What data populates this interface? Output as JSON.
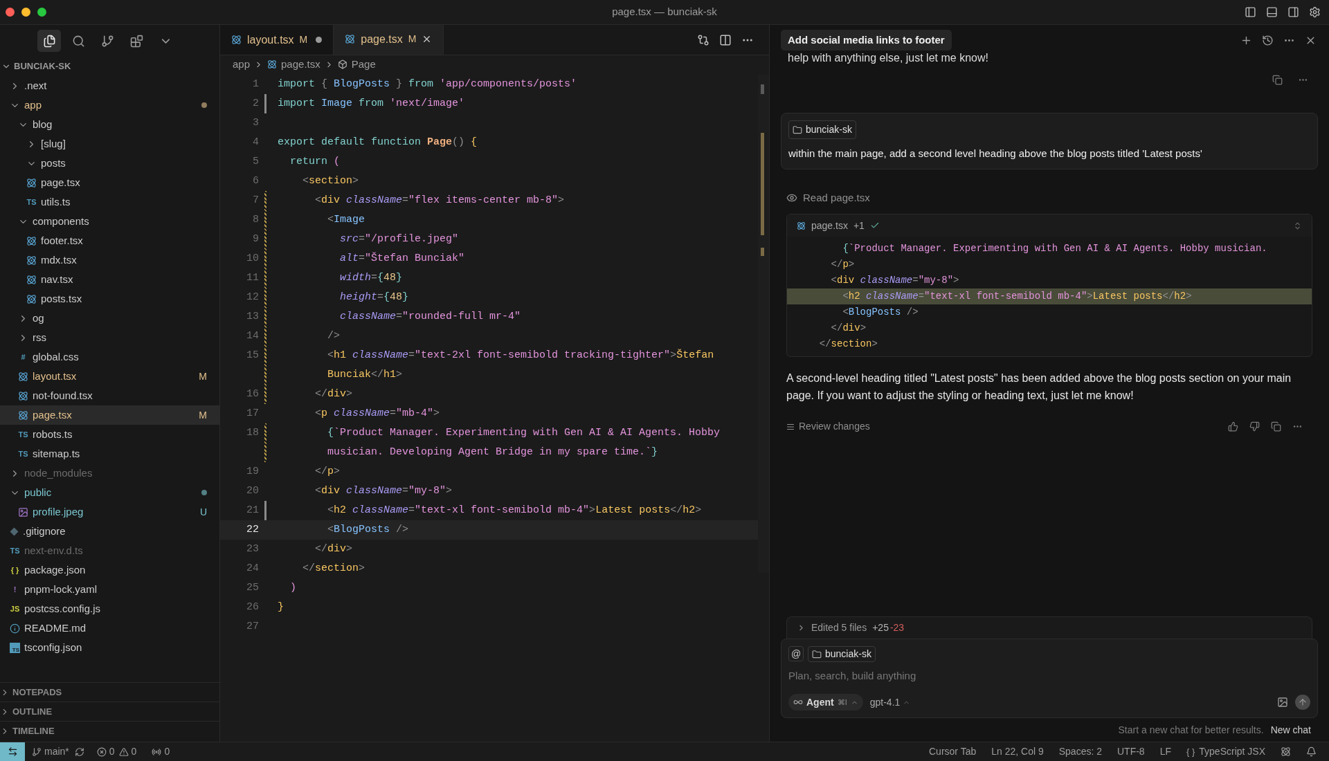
{
  "window": {
    "title": "page.tsx — bunciak-sk"
  },
  "activity": [
    {
      "kind": "explorer",
      "selected": true
    },
    {
      "kind": "search",
      "selected": false
    },
    {
      "kind": "source-control",
      "selected": false
    },
    {
      "kind": "extensions",
      "selected": false
    },
    {
      "kind": "more",
      "selected": false
    }
  ],
  "explorer": {
    "root": "BUNCIAK-SK",
    "items": [
      {
        "name": ".next",
        "kind": "folder",
        "expanded": false,
        "color": "#cccccc"
      },
      {
        "name": "app",
        "kind": "folder",
        "expanded": true,
        "color": "#e2c08d",
        "dot": true,
        "children": [
          {
            "name": "blog",
            "kind": "folder",
            "expanded": true,
            "color": "#cccccc",
            "children": [
              {
                "name": "[slug]",
                "kind": "folder",
                "expanded": false,
                "color": "#cccccc"
              },
              {
                "name": "posts",
                "kind": "folder",
                "expanded": true,
                "color": "#cccccc"
              },
              {
                "name": "page.tsx",
                "kind": "react",
                "color": "#cccccc",
                "selected": false
              },
              {
                "name": "utils.ts",
                "kind": "ts",
                "icon_text": "TS",
                "color": "#cccccc",
                "selected": false
              }
            ]
          },
          {
            "name": "components",
            "kind": "folder",
            "expanded": true,
            "color": "#cccccc",
            "children": [
              {
                "name": "footer.tsx",
                "kind": "react",
                "color": "#cccccc",
                "selected": false
              },
              {
                "name": "mdx.tsx",
                "kind": "react",
                "color": "#cccccc",
                "selected": false
              },
              {
                "name": "nav.tsx",
                "kind": "react",
                "color": "#cccccc",
                "selected": false
              },
              {
                "name": "posts.tsx",
                "kind": "react",
                "color": "#cccccc",
                "selected": false
              }
            ]
          },
          {
            "name": "og",
            "kind": "folder",
            "expanded": false,
            "color": "#cccccc"
          },
          {
            "name": "rss",
            "kind": "folder",
            "expanded": false,
            "color": "#cccccc"
          },
          {
            "name": "global.css",
            "kind": "css",
            "icon_text": "#",
            "color": "#cccccc",
            "selected": false
          },
          {
            "name": "layout.tsx",
            "kind": "react",
            "color": "#e2c08d",
            "badge": "M",
            "selected": false
          },
          {
            "name": "not-found.tsx",
            "kind": "react",
            "color": "#cccccc",
            "selected": false
          },
          {
            "name": "page.tsx",
            "kind": "react",
            "color": "#e2c08d",
            "badge": "M",
            "selected": true
          },
          {
            "name": "robots.ts",
            "kind": "ts",
            "icon_text": "TS",
            "color": "#cccccc",
            "selected": false
          },
          {
            "name": "sitemap.ts",
            "kind": "ts",
            "icon_text": "TS",
            "color": "#cccccc",
            "selected": false
          }
        ]
      },
      {
        "name": "node_modules",
        "kind": "folder",
        "expanded": false,
        "color": "#6b6b6b"
      },
      {
        "name": "public",
        "kind": "folder",
        "expanded": true,
        "color": "#7ac6cf",
        "dot": true,
        "children": [
          {
            "name": "profile.jpeg",
            "kind": "image",
            "color": "#7ac6cf",
            "badge": "U",
            "selected": false
          }
        ]
      },
      {
        "name": ".gitignore",
        "kind": "git",
        "color": "#cccccc",
        "selected": false
      },
      {
        "name": "next-env.d.ts",
        "kind": "ts",
        "icon_text": "TS",
        "color": "#6b6b6b",
        "selected": false
      },
      {
        "name": "package.json",
        "kind": "json",
        "icon_text": "{ }",
        "color": "#cccccc",
        "selected": false
      },
      {
        "name": "pnpm-lock.yaml",
        "kind": "yaml",
        "icon_text": "!",
        "color": "#cccccc",
        "selected": false
      },
      {
        "name": "postcss.config.js",
        "kind": "js",
        "icon_text": "JS",
        "color": "#cccccc",
        "selected": false
      },
      {
        "name": "README.md",
        "kind": "info",
        "color": "#cccccc",
        "selected": false
      },
      {
        "name": "tsconfig.json",
        "kind": "tsconfig",
        "icon_text": "TS",
        "color": "#cccccc",
        "selected": false
      }
    ]
  },
  "sections": [
    {
      "label": "NOTEPADS",
      "expanded": false
    },
    {
      "label": "OUTLINE",
      "expanded": false
    },
    {
      "label": "TIMELINE",
      "expanded": false
    }
  ],
  "tabs": [
    {
      "label": "layout.tsx",
      "status": "M",
      "dirty": true,
      "selected": false
    },
    {
      "label": "page.tsx",
      "status": "M",
      "dirty": false,
      "selected": true
    }
  ],
  "breadcrumb": [
    {
      "label": "app",
      "kind": "folder"
    },
    {
      "label": "page.tsx",
      "kind": "react"
    },
    {
      "label": "Page",
      "kind": "symbol"
    }
  ],
  "code": [
    {
      "number": "1",
      "current": false,
      "modified": false,
      "pending": false,
      "tokens": [
        {
          "kind": "kw",
          "text": "import"
        },
        {
          "kind": "p",
          "text": " { "
        },
        {
          "kind": "comp",
          "text": "BlogPosts"
        },
        {
          "kind": "p",
          "text": " } "
        },
        {
          "kind": "kw",
          "text": "from"
        },
        {
          "kind": "str",
          "text": " 'app/components/posts'"
        }
      ]
    },
    {
      "number": "2",
      "current": false,
      "modified": true,
      "pending": false,
      "tokens": [
        {
          "kind": "kw",
          "text": "import"
        },
        {
          "kind": "comp",
          "text": " Image"
        },
        {
          "kind": "kw",
          "text": " from"
        },
        {
          "kind": "str",
          "text": " 'next/image'"
        }
      ]
    },
    {
      "number": "3",
      "current": false,
      "modified": false,
      "pending": false
    },
    {
      "number": "4",
      "current": false,
      "modified": false,
      "pending": false,
      "tokens": [
        {
          "kind": "kw",
          "text": "export default function"
        },
        {
          "kind": "fn",
          "text": " Page"
        },
        {
          "kind": "p",
          "text": "() "
        },
        {
          "kind": "txt",
          "text": "{"
        }
      ]
    },
    {
      "number": "5",
      "current": false,
      "modified": false,
      "pending": false,
      "tokens": [
        {
          "kind": "kw",
          "text": "  return"
        },
        {
          "kind": "br",
          "text": " ("
        }
      ]
    },
    {
      "number": "6",
      "current": false,
      "modified": false,
      "pending": false,
      "tokens": [
        {
          "kind": "p",
          "text": "    <"
        },
        {
          "kind": "tag",
          "text": "section"
        },
        {
          "kind": "p",
          "text": ">"
        }
      ]
    },
    {
      "number": "7",
      "current": false,
      "modified": false,
      "pending": true,
      "tokens": [
        {
          "kind": "p",
          "text": "      <"
        },
        {
          "kind": "tag",
          "text": "div"
        },
        {
          "kind": "attr",
          "text": " className"
        },
        {
          "kind": "p",
          "text": "="
        },
        {
          "kind": "str",
          "text": "\"flex items-center mb-8\""
        },
        {
          "kind": "p",
          "text": ">"
        }
      ]
    },
    {
      "number": "8",
      "current": false,
      "modified": false,
      "pending": true,
      "tokens": [
        {
          "kind": "p",
          "text": "        <"
        },
        {
          "kind": "comp",
          "text": "Image"
        }
      ]
    },
    {
      "number": "9",
      "current": false,
      "modified": false,
      "pending": true,
      "tokens": [
        {
          "kind": "attr",
          "text": "          src"
        },
        {
          "kind": "p",
          "text": "="
        },
        {
          "kind": "str",
          "text": "\"/profile.jpeg\""
        }
      ]
    },
    {
      "number": "10",
      "current": false,
      "modified": false,
      "pending": true,
      "tokens": [
        {
          "kind": "attr",
          "text": "          alt"
        },
        {
          "kind": "p",
          "text": "="
        },
        {
          "kind": "str",
          "text": "\"Štefan Bunciak\""
        }
      ]
    },
    {
      "number": "11",
      "current": false,
      "modified": false,
      "pending": true,
      "tokens": [
        {
          "kind": "attr",
          "text": "          width"
        },
        {
          "kind": "p",
          "text": "="
        },
        {
          "kind": "brace",
          "text": "{"
        },
        {
          "kind": "num",
          "text": "48"
        },
        {
          "kind": "brace",
          "text": "}"
        }
      ]
    },
    {
      "number": "12",
      "current": false,
      "modified": false,
      "pending": true,
      "tokens": [
        {
          "kind": "attr",
          "text": "          height"
        },
        {
          "kind": "p",
          "text": "="
        },
        {
          "kind": "brace",
          "text": "{"
        },
        {
          "kind": "num",
          "text": "48"
        },
        {
          "kind": "brace",
          "text": "}"
        }
      ]
    },
    {
      "number": "13",
      "current": false,
      "modified": false,
      "pending": true,
      "tokens": [
        {
          "kind": "attr",
          "text": "          className"
        },
        {
          "kind": "p",
          "text": "="
        },
        {
          "kind": "str",
          "text": "\"rounded-full mr-4\""
        }
      ]
    },
    {
      "number": "14",
      "current": false,
      "modified": false,
      "pending": true,
      "tokens": [
        {
          "kind": "p",
          "text": "        />"
        }
      ]
    },
    {
      "number": "15",
      "current": false,
      "modified": false,
      "pending": true,
      "tokens": [
        {
          "kind": "p",
          "text": "        <"
        },
        {
          "kind": "tag",
          "text": "h1"
        },
        {
          "kind": "attr",
          "text": " className"
        },
        {
          "kind": "p",
          "text": "="
        },
        {
          "kind": "str",
          "text": "\"text-2xl font-semibold tracking-tighter\""
        },
        {
          "kind": "p",
          "text": ">"
        },
        {
          "kind": "txt",
          "text": "Štefan"
        }
      ],
      "continuation": [
        {
          "kind": "txt",
          "text": "        Bunciak"
        },
        {
          "kind": "p",
          "text": "</"
        },
        {
          "kind": "tag",
          "text": "h1"
        },
        {
          "kind": "p",
          "text": ">"
        }
      ]
    },
    {
      "number": "16",
      "current": false,
      "modified": false,
      "pending": true,
      "tokens": [
        {
          "kind": "p",
          "text": "      </"
        },
        {
          "kind": "tag",
          "text": "div"
        },
        {
          "kind": "p",
          "text": ">"
        }
      ]
    },
    {
      "number": "17",
      "current": false,
      "modified": false,
      "pending": false,
      "tokens": [
        {
          "kind": "p",
          "text": "      <"
        },
        {
          "kind": "tag",
          "text": "p"
        },
        {
          "kind": "attr",
          "text": " className"
        },
        {
          "kind": "p",
          "text": "="
        },
        {
          "kind": "str",
          "text": "\"mb-4\""
        },
        {
          "kind": "p",
          "text": ">"
        }
      ]
    },
    {
      "number": "18",
      "current": false,
      "modified": false,
      "pending": true,
      "tokens": [
        {
          "kind": "brace",
          "text": "        {"
        },
        {
          "kind": "str",
          "text": "`Product Manager. Experimenting with Gen AI & AI Agents. Hobby"
        }
      ],
      "continuation": [
        {
          "kind": "str",
          "text": "        musician. Developing Agent Bridge in my spare time.`"
        },
        {
          "kind": "brace",
          "text": "}"
        }
      ]
    },
    {
      "number": "19",
      "current": false,
      "modified": false,
      "pending": false,
      "tokens": [
        {
          "kind": "p",
          "text": "      </"
        },
        {
          "kind": "tag",
          "text": "p"
        },
        {
          "kind": "p",
          "text": ">"
        }
      ]
    },
    {
      "number": "20",
      "current": false,
      "modified": false,
      "pending": false,
      "tokens": [
        {
          "kind": "p",
          "text": "      <"
        },
        {
          "kind": "tag",
          "text": "div"
        },
        {
          "kind": "attr",
          "text": " className"
        },
        {
          "kind": "p",
          "text": "="
        },
        {
          "kind": "str",
          "text": "\"my-8\""
        },
        {
          "kind": "p",
          "text": ">"
        }
      ]
    },
    {
      "number": "21",
      "current": false,
      "modified": true,
      "pending": false,
      "tokens": [
        {
          "kind": "p",
          "text": "        <"
        },
        {
          "kind": "tag",
          "text": "h2"
        },
        {
          "kind": "attr",
          "text": " className"
        },
        {
          "kind": "p",
          "text": "="
        },
        {
          "kind": "str",
          "text": "\"text-xl font-semibold mb-4\""
        },
        {
          "kind": "p",
          "text": ">"
        },
        {
          "kind": "txt",
          "text": "Latest posts"
        },
        {
          "kind": "p",
          "text": "</"
        },
        {
          "kind": "tag",
          "text": "h2"
        },
        {
          "kind": "p",
          "text": ">"
        }
      ]
    },
    {
      "number": "22",
      "current": true,
      "modified": false,
      "pending": false,
      "tokens": [
        {
          "kind": "p",
          "text": "        <"
        },
        {
          "kind": "comp",
          "text": "BlogPosts"
        },
        {
          "kind": "p",
          "text": " />"
        }
      ]
    },
    {
      "number": "23",
      "current": false,
      "modified": false,
      "pending": false,
      "tokens": [
        {
          "kind": "p",
          "text": "      </"
        },
        {
          "kind": "tag",
          "text": "div"
        },
        {
          "kind": "p",
          "text": ">"
        }
      ]
    },
    {
      "number": "24",
      "current": false,
      "modified": false,
      "pending": false,
      "tokens": [
        {
          "kind": "p",
          "text": "    </"
        },
        {
          "kind": "tag",
          "text": "section"
        },
        {
          "kind": "p",
          "text": ">"
        }
      ]
    },
    {
      "number": "25",
      "current": false,
      "modified": false,
      "pending": false,
      "tokens": [
        {
          "kind": "br",
          "text": "  )"
        }
      ]
    },
    {
      "number": "26",
      "current": false,
      "modified": false,
      "pending": false,
      "tokens": [
        {
          "kind": "txt",
          "text": "}"
        }
      ]
    },
    {
      "number": "27",
      "current": false,
      "modified": false,
      "pending": false
    }
  ],
  "chat": {
    "title": "Add social media links to footer",
    "previous_reply_tail": "help with anything else, just let me know!",
    "user_message": {
      "context": "bunciak-sk",
      "text": "within the main page, add a second level heading above the blog posts titled 'Latest posts'"
    },
    "tool_step": "Read page.tsx",
    "diff": {
      "file": "page.tsx",
      "count": "+1",
      "lines": [
        {
          "added": false,
          "tokens": [
            {
              "kind": "brace",
              "text": "      {"
            },
            {
              "kind": "str",
              "text": "`Product Manager. Experimenting with Gen AI & AI Agents. Hobby musician."
            }
          ]
        },
        {
          "added": false,
          "tokens": [
            {
              "kind": "p",
              "text": "    </"
            },
            {
              "kind": "tag",
              "text": "p"
            },
            {
              "kind": "p",
              "text": ">"
            }
          ]
        },
        {
          "added": false,
          "tokens": [
            {
              "kind": "p",
              "text": "    <"
            },
            {
              "kind": "tag",
              "text": "div"
            },
            {
              "kind": "attr",
              "text": " className"
            },
            {
              "kind": "p",
              "text": "="
            },
            {
              "kind": "str",
              "text": "\"my-8\""
            },
            {
              "kind": "p",
              "text": ">"
            }
          ]
        },
        {
          "added": true,
          "tokens": [
            {
              "kind": "p",
              "text": "      <"
            },
            {
              "kind": "tag",
              "text": "h2"
            },
            {
              "kind": "attr",
              "text": " className"
            },
            {
              "kind": "p",
              "text": "="
            },
            {
              "kind": "str",
              "text": "\"text-xl font-semibold mb-4\""
            },
            {
              "kind": "p",
              "text": ">"
            },
            {
              "kind": "txt",
              "text": "Latest posts"
            },
            {
              "kind": "p",
              "text": "</"
            },
            {
              "kind": "tag",
              "text": "h2"
            },
            {
              "kind": "p",
              "text": ">"
            }
          ]
        },
        {
          "added": false,
          "tokens": [
            {
              "kind": "p",
              "text": "      <"
            },
            {
              "kind": "comp",
              "text": "BlogPosts"
            },
            {
              "kind": "p",
              "text": " />"
            }
          ]
        },
        {
          "added": false,
          "tokens": [
            {
              "kind": "p",
              "text": "    </"
            },
            {
              "kind": "tag",
              "text": "div"
            },
            {
              "kind": "p",
              "text": ">"
            }
          ]
        },
        {
          "added": false,
          "tokens": [
            {
              "kind": "p",
              "text": "  </"
            },
            {
              "kind": "tag",
              "text": "section"
            },
            {
              "kind": "p",
              "text": ">"
            }
          ]
        }
      ]
    },
    "reply": "A second-level heading titled \"Latest posts\" has been added above the blog posts section on your main page. If you want to adjust the styling or heading text, just let me know!",
    "review_label": "Review changes",
    "edits": {
      "label": "Edited 5 files",
      "added": "+25",
      "removed": "-23"
    },
    "input": {
      "mention": "@",
      "context": "bunciak-sk",
      "placeholder": "Plan, search, build anything",
      "mode": "Agent",
      "shortcut": "⌘I",
      "model": "gpt-4.1"
    },
    "hint": "Start a new chat for better results.",
    "new_chat": "New chat"
  },
  "status_bar": {
    "branch": "main*",
    "errors": "0",
    "warnings": "0",
    "ports": "0",
    "right": [
      "Cursor Tab",
      "Ln 22, Col 9",
      "Spaces: 2",
      "UTF-8",
      "LF"
    ],
    "language_icon": "{ }",
    "language": "TypeScript JSX"
  }
}
